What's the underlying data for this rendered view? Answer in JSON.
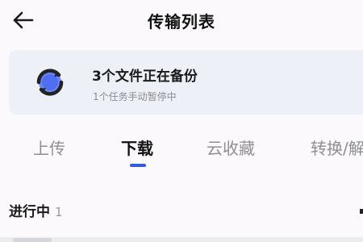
{
  "header": {
    "title": "传输列表",
    "back_icon": "arrow-left-icon"
  },
  "backup_card": {
    "icon": "sync-icon",
    "title": "3个文件正在备份",
    "subtitle": "1个任务手动暂停中",
    "icon_colors": {
      "ring": "#222222",
      "inner": "#5b7cf5"
    }
  },
  "tabs": [
    {
      "label": "上传",
      "active": false
    },
    {
      "label": "下载",
      "active": true
    },
    {
      "label": "云收藏",
      "active": false
    },
    {
      "label": "转换/解",
      "active": false
    }
  ],
  "tab_indicator_color": "#2f5bea",
  "section": {
    "label": "进行中",
    "count": "1"
  }
}
